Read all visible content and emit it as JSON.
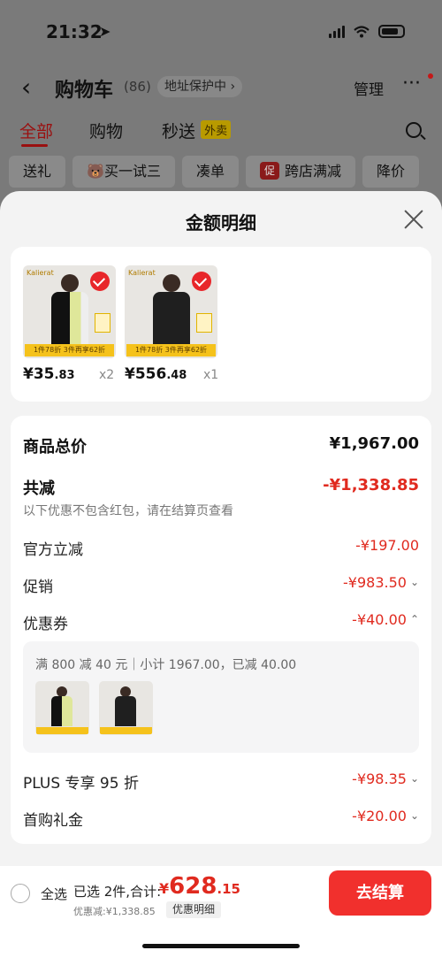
{
  "status_bar": {
    "time": "21:32",
    "location_glyph": "➤"
  },
  "nav": {
    "back_glyph": "‹",
    "title": "购物车",
    "count": "(86)",
    "address_protect": "地址保护中 ›",
    "manage": "管理",
    "more_glyph": "···"
  },
  "tabs": {
    "all": "全部",
    "shopping": "购物",
    "flash": "秒送",
    "flash_tag": "外卖"
  },
  "chips": {
    "gift": "送礼",
    "try": "买一试三",
    "combine": "凑单",
    "promo_icon": "促",
    "cross_store": "跨店满减",
    "price_drop": "降价"
  },
  "sheet": {
    "title": "金额明细",
    "products": [
      {
        "price_int": "¥35",
        "price_dec": ".83",
        "qty": "x2",
        "banner": "1件78折  3件再享62折",
        "brand": "Kalierat"
      },
      {
        "price_int": "¥556",
        "price_dec": ".48",
        "qty": "x1",
        "banner": "1件78折  3件再享62折",
        "brand": "Kalierat"
      }
    ],
    "detail": {
      "goods_total_label": "商品总价",
      "goods_total_value": "¥1,967.00",
      "reduce_label": "共减",
      "reduce_value": "-¥1,338.85",
      "reduce_note": "以下优惠不包含红包，请在结算页查看",
      "official_label": "官方立减",
      "official_value": "-¥197.00",
      "promo_label": "促销",
      "promo_value": "-¥983.50",
      "coupon_label": "优惠券",
      "coupon_value": "-¥40.00",
      "coupon_info": "满 800 减 40 元｜小计 1967.00，已减 40.00",
      "plus_label": "PLUS 专享 95 折",
      "plus_value": "-¥98.35",
      "first_label": "首购礼金",
      "first_value": "-¥20.00",
      "chevron_down": "⌄",
      "chevron_up": "⌃"
    }
  },
  "bottom": {
    "select_all": "全选",
    "selected": "已选 2件,合计:",
    "currency": "¥",
    "total_int": "628",
    "total_dec": ".15",
    "saved": "优惠减:¥1,338.85",
    "detail_btn": "优惠明细",
    "checkout": "去结算"
  },
  "colors": {
    "accent": "#e02a1f",
    "checkout": "#f1302d",
    "banner": "#f5c21b"
  }
}
